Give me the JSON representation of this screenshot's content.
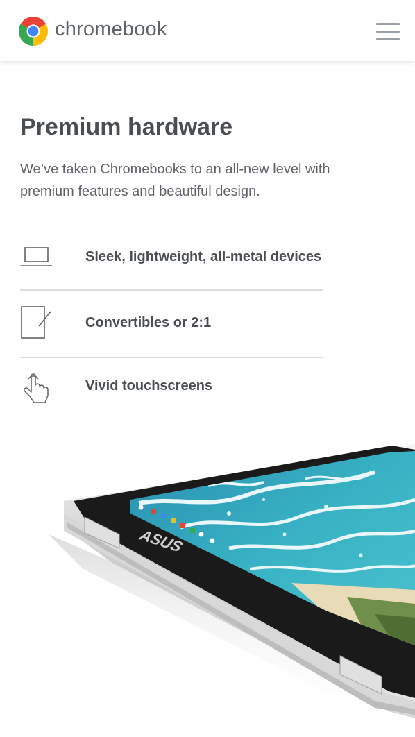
{
  "header": {
    "brand": "chromebook",
    "logo_icon": "chrome-logo-icon",
    "menu_icon": "hamburger-menu-icon"
  },
  "main": {
    "headline": "Premium hardware",
    "intro": "We’ve taken Chromebooks to an all-new level with premium features and beautiful design.",
    "features": [
      {
        "icon": "laptop-icon",
        "label": "Sleek, lightweight, all-metal devices"
      },
      {
        "icon": "convertible-tablet-icon",
        "label": "Convertibles or 2:1"
      },
      {
        "icon": "touch-hand-icon",
        "label": "Vivid touchscreens"
      }
    ],
    "device_logo": "ASUS"
  },
  "colors": {
    "text_dark": "#4a4e52",
    "text_body": "#5f6368",
    "divider": "#dadce0",
    "chrome_red": "#ea4335",
    "chrome_yellow": "#fbbc05",
    "chrome_green": "#34a853",
    "chrome_blue": "#4285f4"
  }
}
